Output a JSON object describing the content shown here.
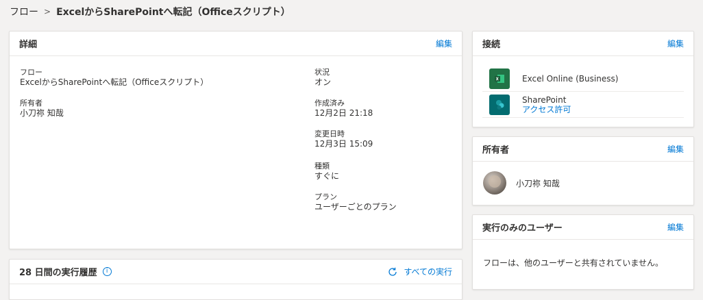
{
  "breadcrumb": {
    "root": "フロー",
    "separator": ">",
    "current": "ExcelからSharePointへ転記（Officeスクリプト）"
  },
  "details": {
    "header": "詳細",
    "edit": "編集",
    "flow_label": "フロー",
    "flow_value": "ExcelからSharePointへ転記（Officeスクリプト）",
    "owner_label": "所有者",
    "owner_value": "小刀祢 知哉",
    "status_label": "状況",
    "status_value": "オン",
    "created_label": "作成済み",
    "created_value": "12月2日 21:18",
    "modified_label": "変更日時",
    "modified_value": "12月3日 15:09",
    "type_label": "種類",
    "type_value": "すぐに",
    "plan_label": "プラン",
    "plan_value": "ユーザーごとのプラン"
  },
  "history": {
    "header": "28 日間の実行履歴",
    "all_runs": "すべての実行"
  },
  "connections": {
    "header": "接続",
    "edit": "編集",
    "items": [
      {
        "name": "Excel Online (Business)",
        "icon": "excel-icon",
        "color": "#217346"
      },
      {
        "name": "SharePoint",
        "action": "アクセス許可",
        "icon": "sharepoint-icon",
        "color": "#036c70"
      }
    ]
  },
  "owners": {
    "header": "所有者",
    "edit": "編集",
    "name": "小刀祢 知哉"
  },
  "run_only": {
    "header": "実行のみのユーザー",
    "edit": "編集",
    "message": "フローは、他のユーザーと共有されていません。"
  },
  "colors": {
    "accent": "#0078d4",
    "background": "#f3f2f1"
  }
}
